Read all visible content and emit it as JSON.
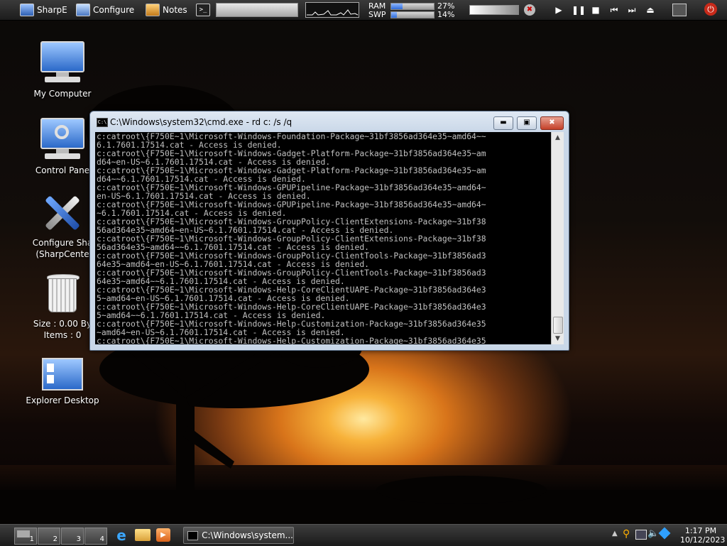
{
  "topbar": {
    "start_label": "SharpE",
    "configure_label": "Configure",
    "notes_label": "Notes",
    "ram_label": "RAM",
    "ram_percent": "27%",
    "ram_value": 27,
    "swp_label": "SWP",
    "swp_percent": "14%",
    "swp_value": 14
  },
  "desktop": {
    "icons": [
      {
        "label": "My Computer",
        "icon": "computer-icon"
      },
      {
        "label": "Control Pane",
        "icon": "control-panel-icon"
      },
      {
        "label": "Configure Sha",
        "label2": "(SharpCente",
        "icon": "tools-icon"
      },
      {
        "label": "Size : 0.00 By",
        "label2": "Items : 0",
        "icon": "recycle-bin-icon"
      },
      {
        "label": "Explorer Desktop",
        "icon": "explorer-desktop-icon"
      }
    ]
  },
  "cmd_window": {
    "title": "C:\\Windows\\system32\\cmd.exe - rd  c: /s /q",
    "icon_text": "C:\\",
    "lines": [
      "c:catroot\\{F750E~1\\Microsoft-Windows-Foundation-Package~31bf3856ad364e35~amd64~~",
      "6.1.7601.17514.cat - Access is denied.",
      "c:catroot\\{F750E~1\\Microsoft-Windows-Gadget-Platform-Package~31bf3856ad364e35~am",
      "d64~en-US~6.1.7601.17514.cat - Access is denied.",
      "c:catroot\\{F750E~1\\Microsoft-Windows-Gadget-Platform-Package~31bf3856ad364e35~am",
      "d64~~6.1.7601.17514.cat - Access is denied.",
      "c:catroot\\{F750E~1\\Microsoft-Windows-GPUPipeline-Package~31bf3856ad364e35~amd64~",
      "en-US~6.1.7601.17514.cat - Access is denied.",
      "c:catroot\\{F750E~1\\Microsoft-Windows-GPUPipeline-Package~31bf3856ad364e35~amd64~",
      "~6.1.7601.17514.cat - Access is denied.",
      "c:catroot\\{F750E~1\\Microsoft-Windows-GroupPolicy-ClientExtensions-Package~31bf38",
      "56ad364e35~amd64~en-US~6.1.7601.17514.cat - Access is denied.",
      "c:catroot\\{F750E~1\\Microsoft-Windows-GroupPolicy-ClientExtensions-Package~31bf38",
      "56ad364e35~amd64~~6.1.7601.17514.cat - Access is denied.",
      "c:catroot\\{F750E~1\\Microsoft-Windows-GroupPolicy-ClientTools-Package~31bf3856ad3",
      "64e35~amd64~en-US~6.1.7601.17514.cat - Access is denied.",
      "c:catroot\\{F750E~1\\Microsoft-Windows-GroupPolicy-ClientTools-Package~31bf3856ad3",
      "64e35~amd64~~6.1.7601.17514.cat - Access is denied.",
      "c:catroot\\{F750E~1\\Microsoft-Windows-Help-CoreClientUAPE-Package~31bf3856ad364e3",
      "5~amd64~en-US~6.1.7601.17514.cat - Access is denied.",
      "c:catroot\\{F750E~1\\Microsoft-Windows-Help-CoreClientUAPE-Package~31bf3856ad364e3",
      "5~amd64~~6.1.7601.17514.cat - Access is denied.",
      "c:catroot\\{F750E~1\\Microsoft-Windows-Help-Customization-Package~31bf3856ad364e35",
      "~amd64~en-US~6.1.7601.17514.cat - Access is denied.",
      "c:catroot\\{F750E~1\\Microsoft-Windows-Help-Customization-Package~31bf3856ad364e35"
    ]
  },
  "taskbar": {
    "desktops": [
      "1",
      "2",
      "3",
      "4"
    ],
    "task_cmd_label": "C:\\Windows\\system...",
    "time": "1:17 PM",
    "date": "10/12/2023"
  },
  "colors": {
    "accent": "#2f6bd8",
    "close_button": "#c4412a",
    "console_bg": "#000000",
    "console_text": "#c0c0c0"
  }
}
